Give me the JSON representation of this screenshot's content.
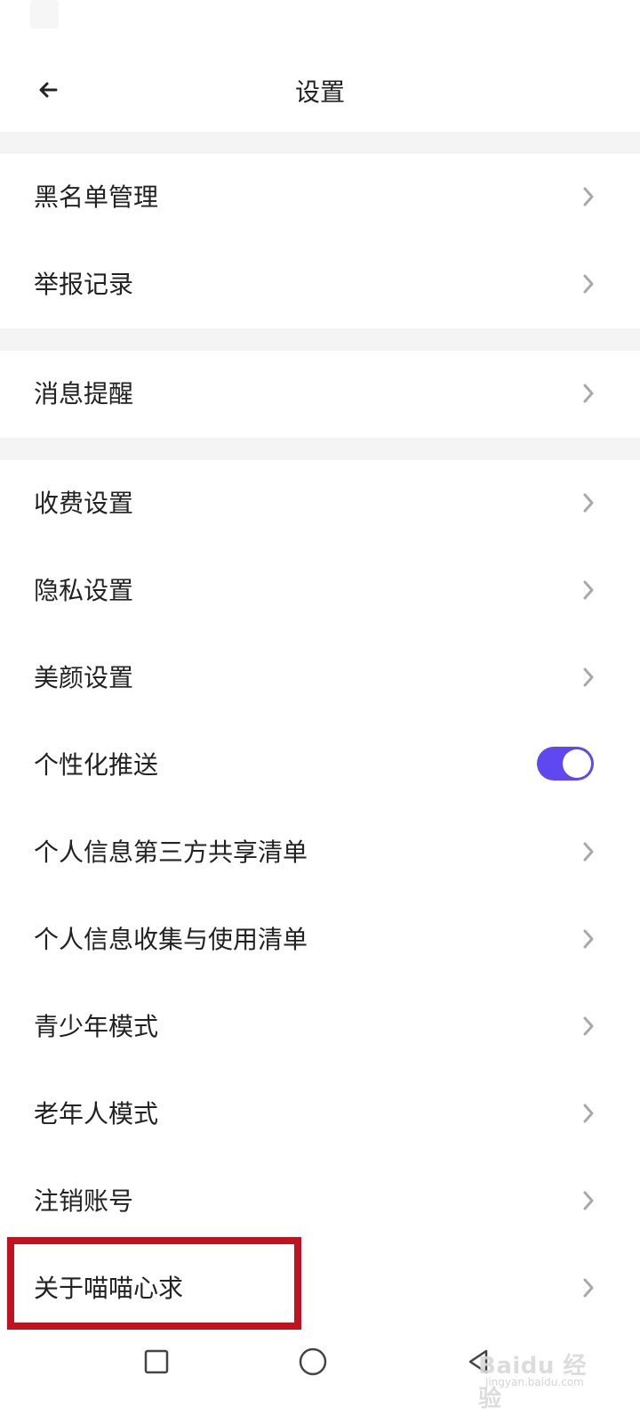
{
  "header": {
    "title": "设置",
    "back_icon": "back-arrow-icon"
  },
  "sections": [
    {
      "items": [
        {
          "label": "黑名单管理",
          "type": "chevron"
        },
        {
          "label": "举报记录",
          "type": "chevron"
        }
      ]
    },
    {
      "items": [
        {
          "label": "消息提醒",
          "type": "chevron"
        }
      ]
    },
    {
      "items": [
        {
          "label": "收费设置",
          "type": "chevron"
        },
        {
          "label": "隐私设置",
          "type": "chevron"
        },
        {
          "label": "美颜设置",
          "type": "chevron"
        },
        {
          "label": "个性化推送",
          "type": "toggle",
          "toggle_on": true
        },
        {
          "label": "个人信息第三方共享清单",
          "type": "chevron"
        },
        {
          "label": "个人信息收集与使用清单",
          "type": "chevron"
        },
        {
          "label": "青少年模式",
          "type": "chevron"
        },
        {
          "label": "老年人模式",
          "type": "chevron"
        },
        {
          "label": "注销账号",
          "type": "chevron"
        },
        {
          "label": "关于喵喵心求",
          "type": "chevron",
          "highlighted": true
        }
      ]
    }
  ],
  "colors": {
    "toggle_accent": "#6048f0",
    "highlight_border": "#c1121f",
    "divider": "#f4f4f4",
    "chevron": "#a9a9a9"
  },
  "nav": {
    "recent_icon": "square-icon",
    "home_icon": "circle-icon",
    "back_icon": "triangle-back-icon"
  },
  "watermark": {
    "main": "Baidu 经验",
    "sub": "jingyan.baidu.com"
  }
}
